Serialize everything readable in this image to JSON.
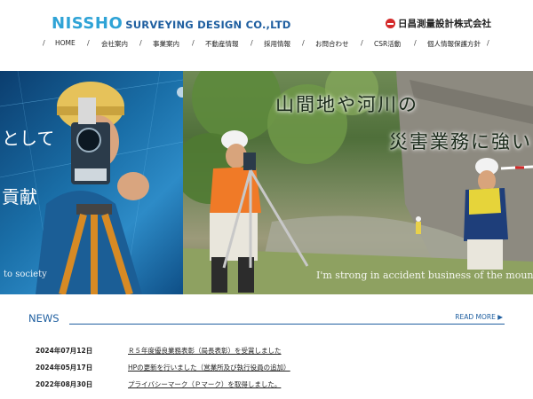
{
  "header": {
    "logo_main": "NISSHO",
    "logo_sub": "SURVEYING DESIGN CO.,LTD",
    "brand_name": "日昌測量設計株式会社"
  },
  "nav": {
    "items": [
      {
        "label": "HOME"
      },
      {
        "label": "会社案内"
      },
      {
        "label": "事業案内"
      },
      {
        "label": "不動産情報"
      },
      {
        "label": "採用情報"
      },
      {
        "label": "お問合わせ"
      },
      {
        "label": "CSR活動"
      },
      {
        "label": "個人情報保護方針"
      }
    ],
    "separator": "/"
  },
  "hero": {
    "left_text_jp1": "として",
    "left_text_jp2": "貢献",
    "left_text_en": "to society",
    "right_copy_jp1": "山間地や河川の",
    "right_copy_jp2": "災害業務に強い",
    "right_text_en": "I'm strong in accident business of the mount"
  },
  "news": {
    "title": "NEWS",
    "read_more": "READ MORE ▶",
    "items": [
      {
        "date": "2024年07月12日",
        "text": "Ｒ５年度優良業務表彰（局長表彰）を受賞しました"
      },
      {
        "date": "2024年05月17日",
        "text": "HPの更新を行いました（営業所及び執行役員の追加）"
      },
      {
        "date": "2022年08月30日",
        "text": "プライバシーマーク（Ｐマーク）を取得しました。"
      }
    ]
  },
  "colors": {
    "accent": "#1f5fa0",
    "logo_blue": "#2fa3d6",
    "brand_red": "#d42a2a"
  }
}
